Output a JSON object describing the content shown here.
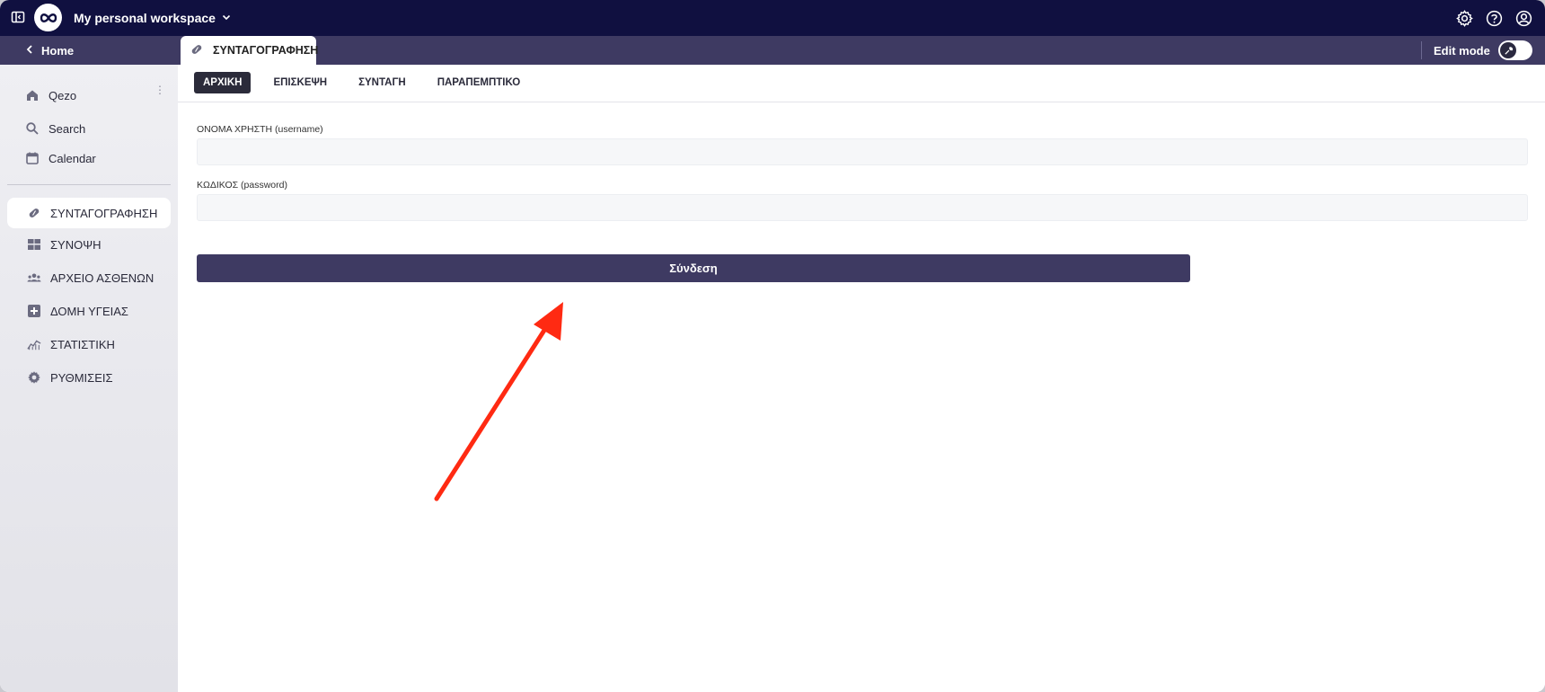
{
  "topbar": {
    "workspace": "My personal workspace"
  },
  "subbar": {
    "home": "Home",
    "page_tab": "ΣΥΝΤΑΓΟΓΡΑΦΗΣΗ",
    "edit_mode": "Edit mode",
    "edit_mode_on": false
  },
  "sidebar": {
    "top_items": [
      {
        "label": "Qezo",
        "icon": "home-icon"
      },
      {
        "label": "Search",
        "icon": "search-icon"
      },
      {
        "label": "Calendar",
        "icon": "calendar-icon"
      }
    ],
    "pages": [
      {
        "label": "ΣΥΝΤΑΓΟΓΡΑΦΗΣΗ",
        "icon": "pill-icon",
        "active": true
      },
      {
        "label": "ΣΥΝΟΨΗ",
        "icon": "dashboard-icon"
      },
      {
        "label": "ΑΡΧΕΙΟ ΑΣΘΕΝΩΝ",
        "icon": "users-icon"
      },
      {
        "label": "ΔΟΜΗ ΥΓΕΙΑΣ",
        "icon": "plus-square-icon"
      },
      {
        "label": "ΣΤΑΤΙΣΤΙΚΗ",
        "icon": "chart-icon"
      },
      {
        "label": "ΡΥΘΜΙΣΕΙΣ",
        "icon": "gear-icon"
      }
    ]
  },
  "main": {
    "tabs": [
      {
        "label": "ΑΡΧΙΚΗ",
        "active": true
      },
      {
        "label": "ΕΠΙΣΚΕΨΗ"
      },
      {
        "label": "ΣΥΝΤΑΓΗ"
      },
      {
        "label": "ΠΑΡΑΠΕΜΠΤΙΚΟ"
      }
    ],
    "username_label": "ΟΝΟΜΑ ΧΡΗΣΤΗ (username)",
    "username_value": "",
    "password_label": "ΚΩΔΙΚΟΣ (password)",
    "password_value": "",
    "login_button": "Σύνδεση"
  },
  "colors": {
    "topbar": "#101040",
    "subbar": "#3e3a62",
    "button": "#3e3a62",
    "annotation_arrow": "#ff2a12"
  }
}
